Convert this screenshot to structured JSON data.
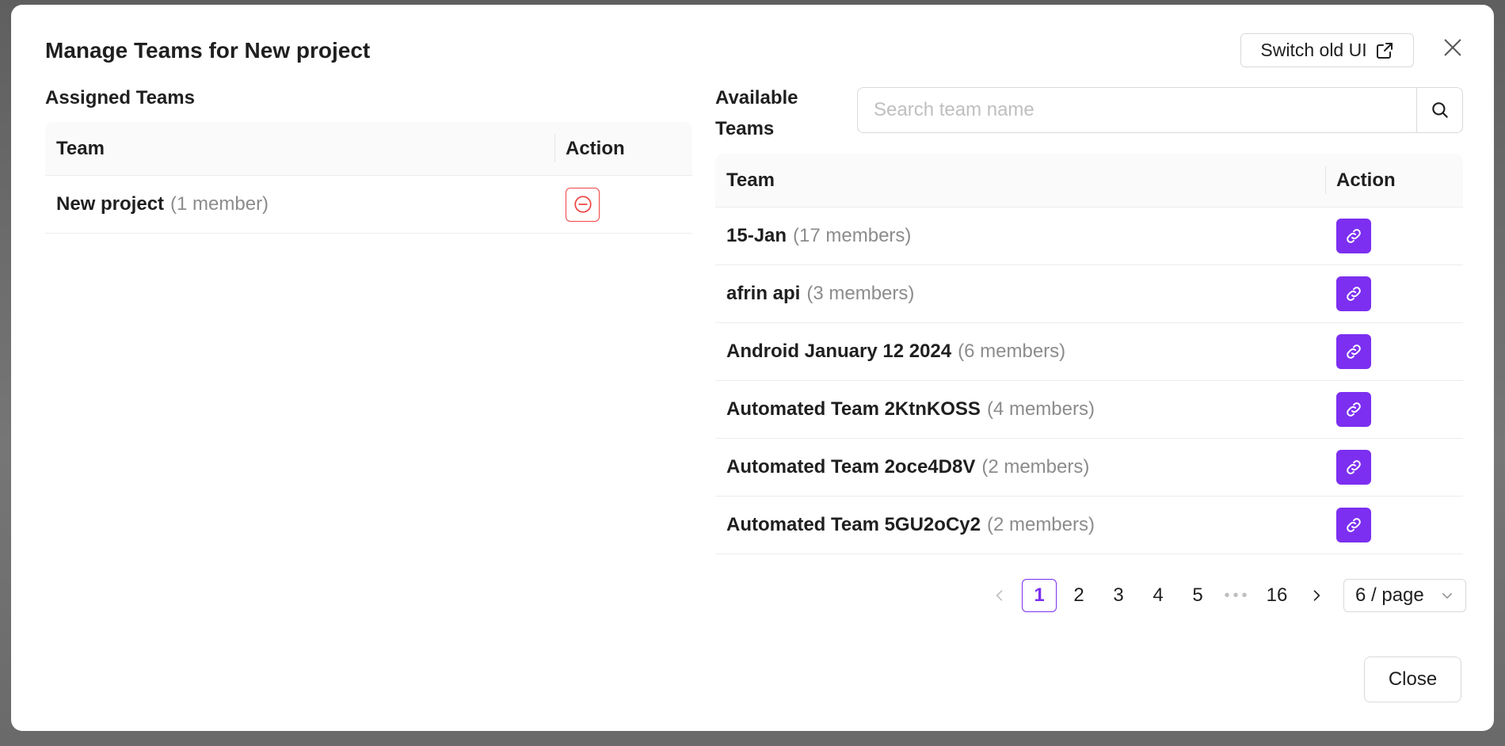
{
  "modal": {
    "title": "Manage Teams for New project",
    "switch_label": "Switch old UI",
    "close_label": "Close"
  },
  "assigned": {
    "title": "Assigned Teams",
    "headers": {
      "team": "Team",
      "action": "Action"
    },
    "rows": [
      {
        "name": "New project",
        "count": "(1 member)"
      }
    ]
  },
  "available": {
    "title": "Available Teams",
    "search_placeholder": "Search team name",
    "headers": {
      "team": "Team",
      "action": "Action"
    },
    "rows": [
      {
        "name": "15-Jan",
        "count": "(17 members)"
      },
      {
        "name": "afrin api",
        "count": "(3 members)"
      },
      {
        "name": "Android January 12 2024",
        "count": "(6 members)"
      },
      {
        "name": "Automated Team 2KtnKOSS",
        "count": "(4 members)"
      },
      {
        "name": "Automated Team 2oce4D8V",
        "count": "(2 members)"
      },
      {
        "name": "Automated Team 5GU2oCy2",
        "count": "(2 members)"
      }
    ]
  },
  "pagination": {
    "pages": [
      "1",
      "2",
      "3",
      "4",
      "5"
    ],
    "ellipsis": "•••",
    "last_page": "16",
    "current": "1",
    "page_size": "6 / page"
  },
  "colors": {
    "accent": "#7c2ff0",
    "danger": "#ef4444"
  }
}
